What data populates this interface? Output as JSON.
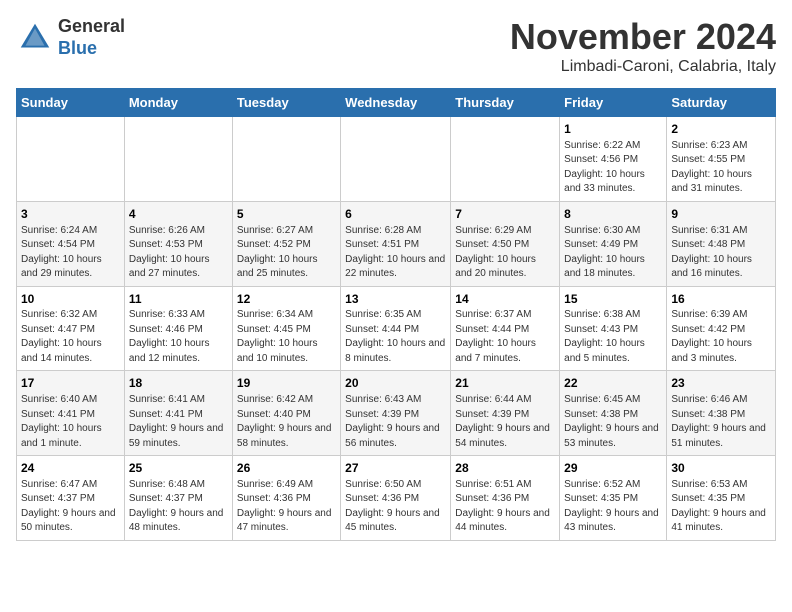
{
  "logo": {
    "general": "General",
    "blue": "Blue"
  },
  "header": {
    "month": "November 2024",
    "location": "Limbadi-Caroni, Calabria, Italy"
  },
  "weekdays": [
    "Sunday",
    "Monday",
    "Tuesday",
    "Wednesday",
    "Thursday",
    "Friday",
    "Saturday"
  ],
  "weeks": [
    [
      {
        "day": "",
        "info": ""
      },
      {
        "day": "",
        "info": ""
      },
      {
        "day": "",
        "info": ""
      },
      {
        "day": "",
        "info": ""
      },
      {
        "day": "",
        "info": ""
      },
      {
        "day": "1",
        "info": "Sunrise: 6:22 AM\nSunset: 4:56 PM\nDaylight: 10 hours and 33 minutes."
      },
      {
        "day": "2",
        "info": "Sunrise: 6:23 AM\nSunset: 4:55 PM\nDaylight: 10 hours and 31 minutes."
      }
    ],
    [
      {
        "day": "3",
        "info": "Sunrise: 6:24 AM\nSunset: 4:54 PM\nDaylight: 10 hours and 29 minutes."
      },
      {
        "day": "4",
        "info": "Sunrise: 6:26 AM\nSunset: 4:53 PM\nDaylight: 10 hours and 27 minutes."
      },
      {
        "day": "5",
        "info": "Sunrise: 6:27 AM\nSunset: 4:52 PM\nDaylight: 10 hours and 25 minutes."
      },
      {
        "day": "6",
        "info": "Sunrise: 6:28 AM\nSunset: 4:51 PM\nDaylight: 10 hours and 22 minutes."
      },
      {
        "day": "7",
        "info": "Sunrise: 6:29 AM\nSunset: 4:50 PM\nDaylight: 10 hours and 20 minutes."
      },
      {
        "day": "8",
        "info": "Sunrise: 6:30 AM\nSunset: 4:49 PM\nDaylight: 10 hours and 18 minutes."
      },
      {
        "day": "9",
        "info": "Sunrise: 6:31 AM\nSunset: 4:48 PM\nDaylight: 10 hours and 16 minutes."
      }
    ],
    [
      {
        "day": "10",
        "info": "Sunrise: 6:32 AM\nSunset: 4:47 PM\nDaylight: 10 hours and 14 minutes."
      },
      {
        "day": "11",
        "info": "Sunrise: 6:33 AM\nSunset: 4:46 PM\nDaylight: 10 hours and 12 minutes."
      },
      {
        "day": "12",
        "info": "Sunrise: 6:34 AM\nSunset: 4:45 PM\nDaylight: 10 hours and 10 minutes."
      },
      {
        "day": "13",
        "info": "Sunrise: 6:35 AM\nSunset: 4:44 PM\nDaylight: 10 hours and 8 minutes."
      },
      {
        "day": "14",
        "info": "Sunrise: 6:37 AM\nSunset: 4:44 PM\nDaylight: 10 hours and 7 minutes."
      },
      {
        "day": "15",
        "info": "Sunrise: 6:38 AM\nSunset: 4:43 PM\nDaylight: 10 hours and 5 minutes."
      },
      {
        "day": "16",
        "info": "Sunrise: 6:39 AM\nSunset: 4:42 PM\nDaylight: 10 hours and 3 minutes."
      }
    ],
    [
      {
        "day": "17",
        "info": "Sunrise: 6:40 AM\nSunset: 4:41 PM\nDaylight: 10 hours and 1 minute."
      },
      {
        "day": "18",
        "info": "Sunrise: 6:41 AM\nSunset: 4:41 PM\nDaylight: 9 hours and 59 minutes."
      },
      {
        "day": "19",
        "info": "Sunrise: 6:42 AM\nSunset: 4:40 PM\nDaylight: 9 hours and 58 minutes."
      },
      {
        "day": "20",
        "info": "Sunrise: 6:43 AM\nSunset: 4:39 PM\nDaylight: 9 hours and 56 minutes."
      },
      {
        "day": "21",
        "info": "Sunrise: 6:44 AM\nSunset: 4:39 PM\nDaylight: 9 hours and 54 minutes."
      },
      {
        "day": "22",
        "info": "Sunrise: 6:45 AM\nSunset: 4:38 PM\nDaylight: 9 hours and 53 minutes."
      },
      {
        "day": "23",
        "info": "Sunrise: 6:46 AM\nSunset: 4:38 PM\nDaylight: 9 hours and 51 minutes."
      }
    ],
    [
      {
        "day": "24",
        "info": "Sunrise: 6:47 AM\nSunset: 4:37 PM\nDaylight: 9 hours and 50 minutes."
      },
      {
        "day": "25",
        "info": "Sunrise: 6:48 AM\nSunset: 4:37 PM\nDaylight: 9 hours and 48 minutes."
      },
      {
        "day": "26",
        "info": "Sunrise: 6:49 AM\nSunset: 4:36 PM\nDaylight: 9 hours and 47 minutes."
      },
      {
        "day": "27",
        "info": "Sunrise: 6:50 AM\nSunset: 4:36 PM\nDaylight: 9 hours and 45 minutes."
      },
      {
        "day": "28",
        "info": "Sunrise: 6:51 AM\nSunset: 4:36 PM\nDaylight: 9 hours and 44 minutes."
      },
      {
        "day": "29",
        "info": "Sunrise: 6:52 AM\nSunset: 4:35 PM\nDaylight: 9 hours and 43 minutes."
      },
      {
        "day": "30",
        "info": "Sunrise: 6:53 AM\nSunset: 4:35 PM\nDaylight: 9 hours and 41 minutes."
      }
    ]
  ]
}
